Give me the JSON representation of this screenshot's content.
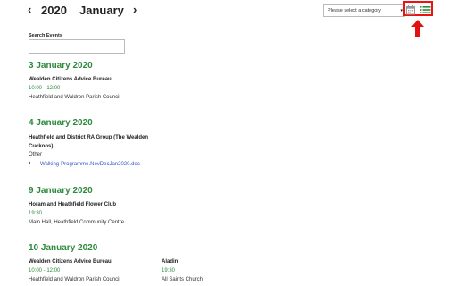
{
  "header": {
    "prev_arrow": "‹",
    "next_arrow": "›",
    "year": "2020",
    "month": "January",
    "category_select": "Please select a category",
    "caret": "▾"
  },
  "search": {
    "label": "Search Events",
    "value": ""
  },
  "icons": {
    "calendar_view": "calendar-icon",
    "list_view": "list-icon",
    "annotation": "red-up-arrow"
  },
  "colors": {
    "accent_green": "#2f8a3e",
    "link_blue": "#3355cc",
    "highlight_red": "#e11111"
  },
  "days": [
    {
      "date": "3 January 2020",
      "events": [
        {
          "title": "Wealden Citizens Advice Bureau",
          "time": "10:00 - 12:00",
          "venue": "Heathfield and Waldron Parish Council"
        }
      ]
    },
    {
      "date": "4 January 2020",
      "events": [
        {
          "title_line1": "Heathfield and District RA Group (The Wealden",
          "title_line2": "Cuckoos)",
          "venue": "Other",
          "attachment_chevron": "›",
          "attachment": "Walking-Programme.NovDecJan2020.doc"
        }
      ]
    },
    {
      "date": "9 January 2020",
      "events": [
        {
          "title": "Horam and Heathfield Flower Club",
          "time": "19:30",
          "venue": "Main Hall, Heathfield Community Centre"
        }
      ]
    },
    {
      "date": "10 January 2020",
      "events": [
        {
          "title": "Wealden Citizens Advice Bureau",
          "time": "10:00 - 12:00",
          "venue": "Heathfield and Waldron Parish Council"
        },
        {
          "title": "Aladin",
          "time": "19:30",
          "venue": "All Saints Church"
        }
      ]
    }
  ]
}
